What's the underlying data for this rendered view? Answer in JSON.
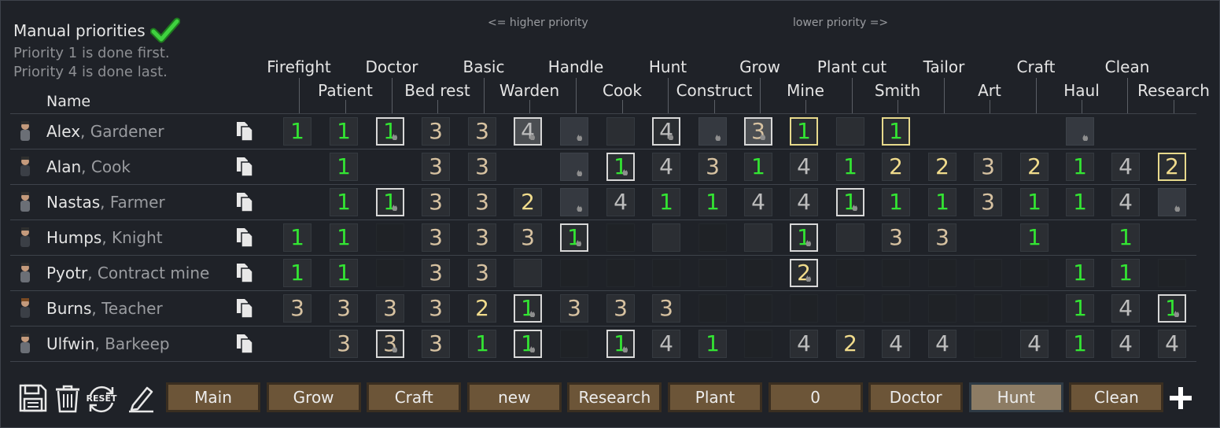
{
  "header": {
    "title": "Manual priorities",
    "hint_line1": "Priority 1 is done first.",
    "hint_line2": "Priority 4 is done last.",
    "higher_priority": "<= higher priority",
    "lower_priority": "lower priority =>",
    "name_column": "Name"
  },
  "work_types": [
    "Firefight",
    "Patient",
    "Doctor",
    "Bed rest",
    "Basic",
    "Warden",
    "Handle",
    "Cook",
    "Hunt",
    "Construct",
    "Grow",
    "Mine",
    "Plant cut",
    "Smith",
    "Tailor",
    "Art",
    "Craft",
    "Haul",
    "Clean",
    "Research"
  ],
  "colonists": [
    {
      "name": "Alex",
      "title": "Gardener",
      "cells": [
        "1n",
        "1n",
        "1b",
        "3n",
        "3n",
        "4l",
        ".nf",
        ".n",
        "4b",
        ".nf",
        "3l",
        "1y",
        ".n",
        "1y",
        "",
        "",
        "",
        ".nf",
        "",
        "",
        ""
      ]
    },
    {
      "name": "Alan",
      "title": "Cook",
      "cells": [
        "",
        "1n",
        "",
        "3n",
        "3n",
        "",
        ".nf",
        "1b",
        "4n",
        "3n",
        "1n",
        "4n",
        "1n",
        "2n",
        "2n",
        "3n",
        "2n",
        "1n",
        "4n",
        "2y"
      ]
    },
    {
      "name": "Nastas",
      "title": "Farmer",
      "cells": [
        "",
        "1n",
        "1b",
        "3n",
        "3n",
        "2n",
        ".nf",
        "4n",
        "1n",
        "1n",
        "4n",
        "4n",
        "1b",
        "1n",
        "1n",
        "3n",
        "1n",
        "1n",
        "4n",
        ".nf"
      ]
    },
    {
      "name": "Humps",
      "title": "Knight",
      "cells": [
        "1n",
        "1n",
        ".e",
        "3n",
        "3n",
        "3n",
        "1b",
        ".e",
        ".n",
        ".e",
        ".n",
        "1b",
        ".n",
        "3n",
        "3n",
        "",
        "1n",
        "",
        "1n",
        ""
      ]
    },
    {
      "name": "Pyotr",
      "title": "Contract mine",
      "cells": [
        "1n",
        "1n",
        ".e",
        "3n",
        "3n",
        ".n",
        ".e",
        ".e",
        ".e",
        ".e",
        ".e",
        "2b",
        ".e",
        ".e",
        ".e",
        ".e",
        ".e",
        "1n",
        "1n",
        ".e"
      ]
    },
    {
      "name": "Burns",
      "title": "Teacher",
      "cells": [
        "3n",
        "3n",
        "3n",
        "3n",
        "2n",
        "1b",
        "3n",
        "3n",
        "3n",
        ".e",
        ".e",
        ".e",
        ".e",
        ".e",
        ".e",
        ".e",
        ".e",
        "1n",
        "4n",
        "1b"
      ]
    },
    {
      "name": "Ulfwin",
      "title": "Barkeep",
      "cells": [
        "",
        "3n",
        "3b",
        "3n",
        "1n",
        "1b",
        ".e",
        "1b",
        "4n",
        "1n",
        ".e",
        "4n",
        "2n",
        "4n",
        "4n",
        ".e",
        "4n",
        "1n",
        "4n",
        "4n"
      ]
    }
  ],
  "toolbar": {
    "icons": [
      "save-icon",
      "trash-icon",
      "reset-icon",
      "edit-icon"
    ],
    "reset_label": "RESET",
    "tabs": [
      "Main",
      "Grow",
      "Craft",
      "new",
      "Research",
      "Plant",
      "0",
      "Doctor",
      "Hunt",
      "Clean"
    ],
    "active_tab": "Hunt"
  },
  "colors": {
    "priority1": "#33e533",
    "priority2": "#f1dc8c",
    "priority3": "#d7c2a1",
    "priority4": "#bdbdbd",
    "tab": "#6c5538",
    "tab_active": "#8d7c64"
  }
}
